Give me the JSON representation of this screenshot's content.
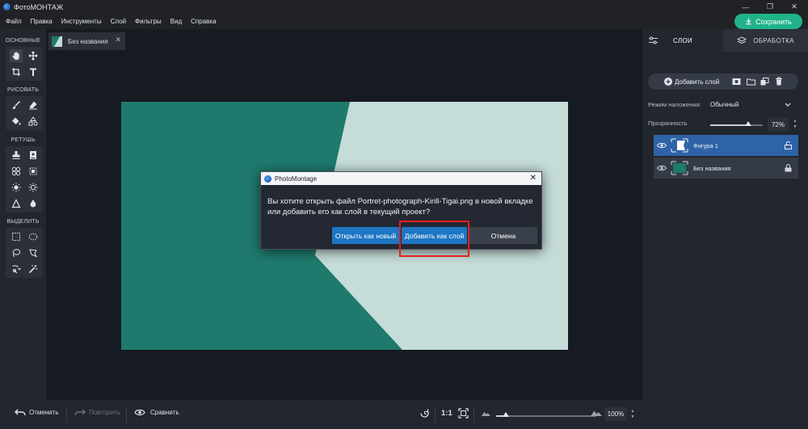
{
  "app": {
    "title": "ФотоМОНТАЖ"
  },
  "window_controls": {
    "minimize": "—",
    "restore": "❐",
    "close": "✕"
  },
  "menu": [
    "Файл",
    "Правка",
    "Инструменты",
    "Слой",
    "Фильтры",
    "Вид",
    "Справка"
  ],
  "save_button": "Сохранить",
  "toolbar": {
    "groups": [
      {
        "title": "ОСНОВНЫЕ",
        "tools": [
          "hand-icon",
          "move-icon",
          "crop-icon",
          "text-icon"
        ]
      },
      {
        "title": "РИСОВАТЬ",
        "tools": [
          "brush-icon",
          "eraser-icon",
          "fill-icon",
          "shapes-icon"
        ]
      },
      {
        "title": "РЕТУШЬ",
        "tools": [
          "stamp-icon",
          "patch-icon",
          "healing-icon",
          "blur-icon",
          "lighten-icon",
          "darken-icon",
          "sharpen-icon",
          "drop-icon"
        ]
      },
      {
        "title": "ВЫДЕЛИТЬ",
        "tools": [
          "rect-select-icon",
          "ellipse-select-icon",
          "lasso-icon",
          "poly-lasso-icon",
          "magic-select-icon",
          "magic-wand-icon"
        ]
      }
    ]
  },
  "document_tab": {
    "name": "Без названия",
    "close": "✕"
  },
  "dialog": {
    "title": "PhotoMontage",
    "message": "Вы хотите открыть файл Portret-photograph-Kirill-Tigai.png в новой вкладке или добавить его как слой в текущий проект?",
    "buttons": {
      "open_new": "Открыть как новый",
      "add_layer": "Добавить как слой",
      "cancel": "Отмена"
    },
    "close": "✕"
  },
  "right_panel": {
    "tabs": {
      "layers": "СЛОИ",
      "processing": "ОБРАБОТКА"
    },
    "add_layer": "Добавить слой",
    "blend_label": "Режим наложения:",
    "blend_value": "Обычный",
    "opacity_label": "Прозрачность",
    "opacity_value": "72%",
    "opacity_fraction": 0.72,
    "layers": [
      {
        "name": "Фигура 1",
        "selected": true
      },
      {
        "name": "Без названия",
        "selected": false
      }
    ]
  },
  "bottom_bar": {
    "undo": "Отменить",
    "redo": "Повторить",
    "compare": "Сравнить",
    "ratio": "1:1",
    "zoom": "100%"
  },
  "colors": {
    "accent_green": "#21b38a",
    "teal": "#1f7a6d",
    "mint": "#c5dcd8",
    "selected_layer": "#2f63a8",
    "dialog_primary": "#1e76c4",
    "highlight": "#e0211d"
  }
}
